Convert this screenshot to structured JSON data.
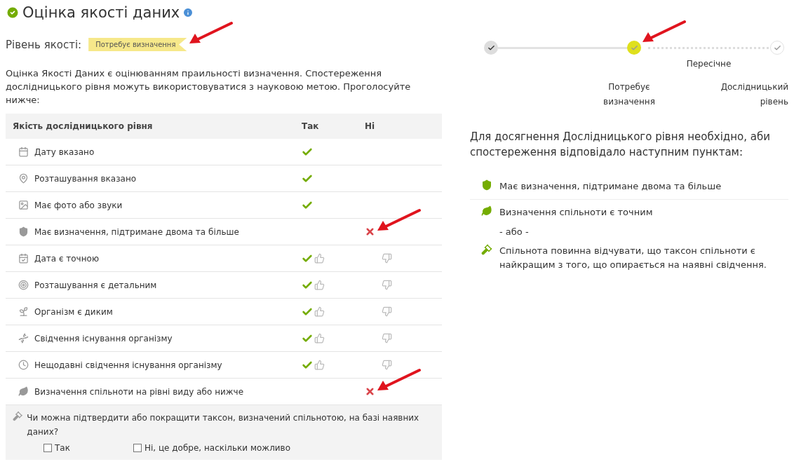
{
  "title": "Оцінка якості даних",
  "quality": {
    "label": "Рівень якості:",
    "badge": "Потребує визначення",
    "highlighted": true
  },
  "intro": "Оцінка Якості Даних є оцінюванням праильності визначення. Спостереження дослідницького рівня можуть використовуватися з науковою метою. Проголосуйте нижче:",
  "table": {
    "columns": [
      "Якість дослідницького рівня",
      "Так",
      "Ні"
    ],
    "rows": [
      {
        "label": "Дату вказано",
        "kind": "auto",
        "passed": true
      },
      {
        "label": "Розташування вказано",
        "kind": "auto",
        "passed": true
      },
      {
        "label": "Має фото або звуки",
        "kind": "auto",
        "passed": true
      },
      {
        "label": "Має визначення, підтримане двома та більше",
        "kind": "auto",
        "passed": false,
        "highlighted": true
      },
      {
        "label": "Дата є точною",
        "kind": "vote",
        "passed": true
      },
      {
        "label": "Розташування є детальним",
        "kind": "vote",
        "passed": true
      },
      {
        "label": "Організм є диким",
        "kind": "vote",
        "passed": true
      },
      {
        "label": "Свідчення існування організму",
        "kind": "vote",
        "passed": true
      },
      {
        "label": "Нещодавні свідчення існування організму",
        "kind": "vote",
        "passed": true
      },
      {
        "label": "Визначення спільноти на рівні виду або нижче",
        "kind": "auto",
        "passed": false,
        "highlighted": true
      }
    ],
    "question": {
      "text": "Чи можна підтвердити або покращити таксон, визначений спільнотою, на базі наявних даних?",
      "options": [
        {
          "label": "Так",
          "checked": false
        },
        {
          "label": "Ні, це добре, наскільки можливо",
          "checked": false
        }
      ]
    }
  },
  "progress": {
    "steps": [
      {
        "selected": false,
        "completed": true
      },
      {
        "label": "Потребує визначення",
        "selected": true,
        "completed": false,
        "highlighted": true
      },
      {
        "label": "Дослідницький рівень",
        "selected": false,
        "completed": false
      }
    ],
    "between_label": "Пересічне"
  },
  "requirements": {
    "intro": "Для досягнення Дослідницького рівня необхідно, аби спостереження відповідало наступним пунктам:",
    "items": [
      {
        "kind": "item",
        "text": "Має визначення, підтримане двома та більше"
      },
      {
        "kind": "item",
        "text": "Визначення спільноти є точним"
      },
      {
        "kind": "or",
        "text": "- або -"
      },
      {
        "kind": "item",
        "text": "Спільнота повинна відчувати, що таксон спільноти є найкращим з того, що опирається на наявні свідчення."
      }
    ]
  }
}
